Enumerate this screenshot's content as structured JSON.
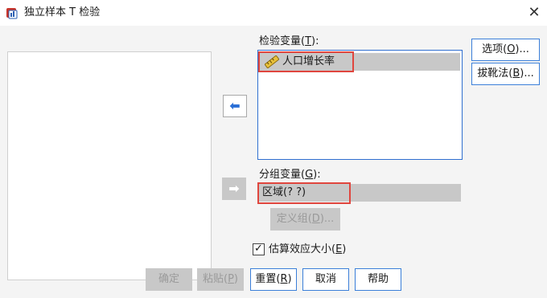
{
  "window": {
    "title": "独立样本 T 检验",
    "close_glyph": "✕"
  },
  "test_vars": {
    "label_prefix": "检验变量(",
    "label_key": "T",
    "label_suffix": "):",
    "items": [
      {
        "label": "人口增长率",
        "icon": "scale-ruler-icon"
      }
    ]
  },
  "grouping": {
    "label_prefix": "分组变量(",
    "label_key": "G",
    "label_suffix": "):",
    "value": "区域(? ?)",
    "define_prefix": "定义组(",
    "define_key": "D",
    "define_suffix": ")..."
  },
  "side_buttons": {
    "options_prefix": "选项(",
    "options_key": "O",
    "options_suffix": ")...",
    "bootstrap_prefix": "拔靴法(",
    "bootstrap_key": "B",
    "bootstrap_suffix": ")..."
  },
  "checkbox": {
    "prefix": "估算效应大小(",
    "key": "E",
    "suffix": ")",
    "checked": true,
    "mark": "✓"
  },
  "footer": {
    "ok": "确定",
    "paste_prefix": "粘贴(",
    "paste_key": "P",
    "paste_suffix": ")",
    "reset_prefix": "重置(",
    "reset_key": "R",
    "reset_suffix": ")",
    "cancel": "取消",
    "help": "帮助"
  },
  "arrows": {
    "move_back": "⬅",
    "move_right": "➡"
  },
  "colors": {
    "accent": "#3b7fd9",
    "highlight": "#e0463e",
    "disabled": "#c8c8c8"
  }
}
